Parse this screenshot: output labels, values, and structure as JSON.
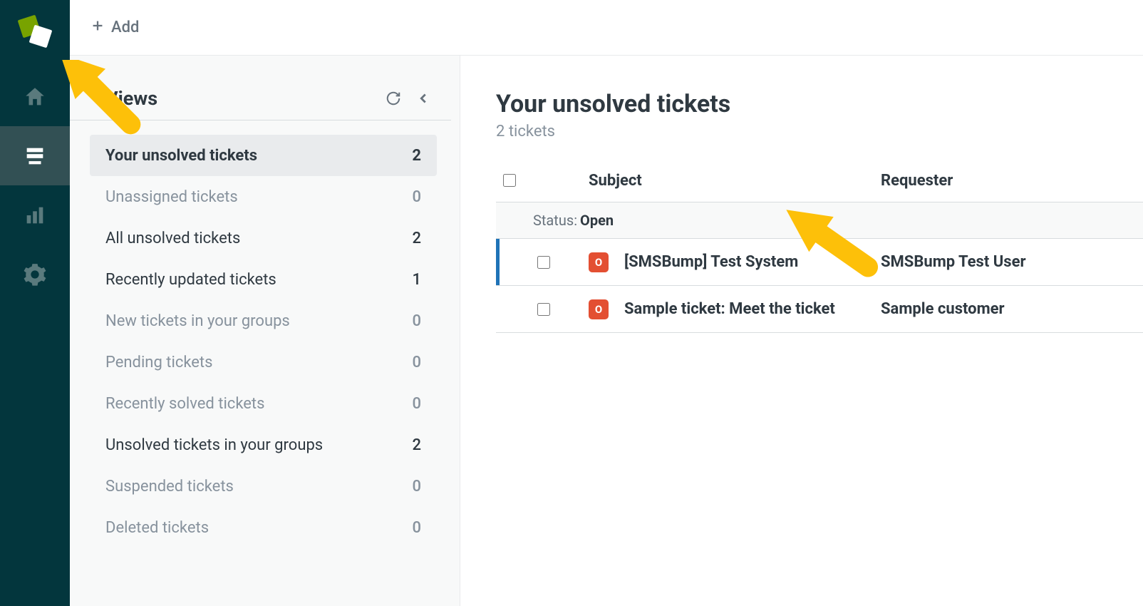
{
  "topbar": {
    "add_label": "Add"
  },
  "views": {
    "title": "Views",
    "items": [
      {
        "label": "Your unsolved tickets",
        "count": "2",
        "selected": true,
        "dim": false
      },
      {
        "label": "Unassigned tickets",
        "count": "0",
        "selected": false,
        "dim": true
      },
      {
        "label": "All unsolved tickets",
        "count": "2",
        "selected": false,
        "dim": false
      },
      {
        "label": "Recently updated tickets",
        "count": "1",
        "selected": false,
        "dim": false
      },
      {
        "label": "New tickets in your groups",
        "count": "0",
        "selected": false,
        "dim": true
      },
      {
        "label": "Pending tickets",
        "count": "0",
        "selected": false,
        "dim": true
      },
      {
        "label": "Recently solved tickets",
        "count": "0",
        "selected": false,
        "dim": true
      },
      {
        "label": "Unsolved tickets in your groups",
        "count": "2",
        "selected": false,
        "dim": false
      },
      {
        "label": "Suspended tickets",
        "count": "0",
        "selected": false,
        "dim": true
      },
      {
        "label": "Deleted tickets",
        "count": "0",
        "selected": false,
        "dim": true
      }
    ]
  },
  "main": {
    "title": "Your unsolved tickets",
    "subcount": "2 tickets",
    "columns": {
      "subject": "Subject",
      "requester": "Requester"
    },
    "group_label": "Status:",
    "group_value": "Open",
    "tickets": [
      {
        "status_letter": "O",
        "subject": "[SMSBump] Test System",
        "requester": "SMSBump Test User",
        "highlighted": true
      },
      {
        "status_letter": "O",
        "subject": "Sample ticket: Meet the ticket",
        "requester": "Sample customer",
        "highlighted": false
      }
    ]
  }
}
